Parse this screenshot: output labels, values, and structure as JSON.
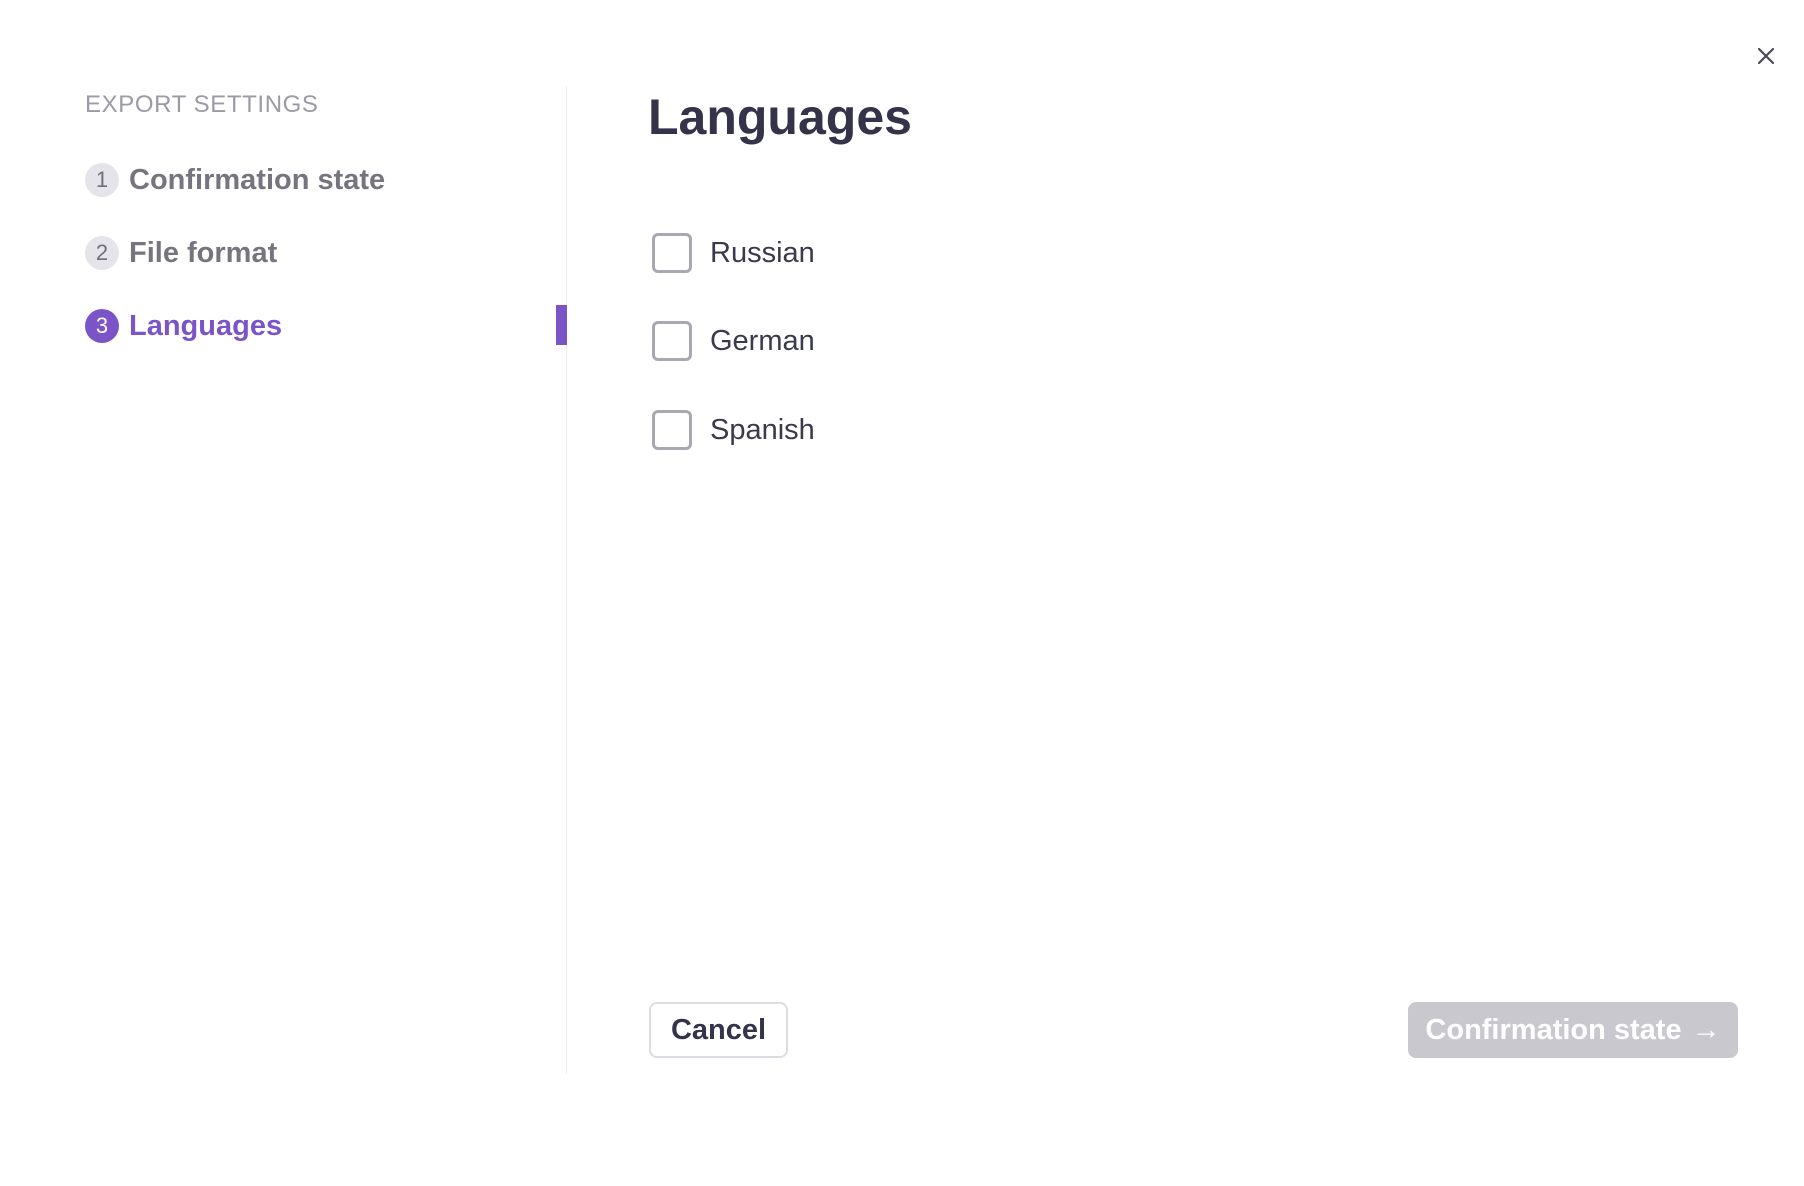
{
  "dialog": {
    "close_icon": "close-icon"
  },
  "sidebar": {
    "heading": "EXPORT SETTINGS",
    "steps": [
      {
        "number": "1",
        "label": "Confirmation state",
        "active": false
      },
      {
        "number": "2",
        "label": "File format",
        "active": false
      },
      {
        "number": "3",
        "label": "Languages",
        "active": true
      }
    ]
  },
  "main": {
    "title": "Languages",
    "options": [
      {
        "label": "Russian",
        "checked": false
      },
      {
        "label": "German",
        "checked": false
      },
      {
        "label": "Spanish",
        "checked": false
      }
    ]
  },
  "footer": {
    "cancel_label": "Cancel",
    "next_label": "Confirmation state",
    "next_arrow": "→",
    "next_disabled": true
  },
  "colors": {
    "accent": "#7b55c7",
    "title_text": "#34334a",
    "muted_text": "#76747f",
    "disabled_button": "#c9c8cf"
  }
}
